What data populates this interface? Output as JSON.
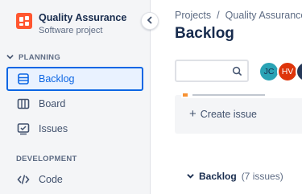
{
  "project": {
    "name": "Quality Assurance",
    "type": "Software project",
    "icon": "project-icon",
    "icon_color": "#ff5630"
  },
  "sidebar": {
    "sections": [
      {
        "label": "PLANNING",
        "items": [
          {
            "label": "Backlog",
            "icon": "backlog-icon",
            "active": true
          },
          {
            "label": "Board",
            "icon": "board-icon",
            "active": false
          },
          {
            "label": "Issues",
            "icon": "issues-icon",
            "active": false
          }
        ]
      },
      {
        "label": "DEVELOPMENT",
        "items": [
          {
            "label": "Code",
            "icon": "code-icon",
            "active": false
          }
        ]
      }
    ],
    "collapse_icon": "chevron-left-icon"
  },
  "breadcrumb": {
    "items": [
      "Projects",
      "Quality Assurance"
    ],
    "separator": "/"
  },
  "page_title": "Backlog",
  "search": {
    "placeholder": "",
    "value": "",
    "icon": "search-icon"
  },
  "avatars": [
    {
      "initials": "JC",
      "color": "#2aa3b5"
    },
    {
      "initials": "HV",
      "color": "#de350b"
    },
    {
      "initials": "",
      "color": "#253858"
    }
  ],
  "sprint": {
    "create_issue_label": "Create issue"
  },
  "backlog": {
    "name": "Backlog",
    "count_label": "(7 issues)"
  },
  "colors": {
    "accent": "#0c66e4",
    "active_bg": "#e9f2ff",
    "sidebar_bg": "#f4f5f7",
    "text_primary": "#172b4d",
    "text_secondary": "#5e6c84"
  }
}
